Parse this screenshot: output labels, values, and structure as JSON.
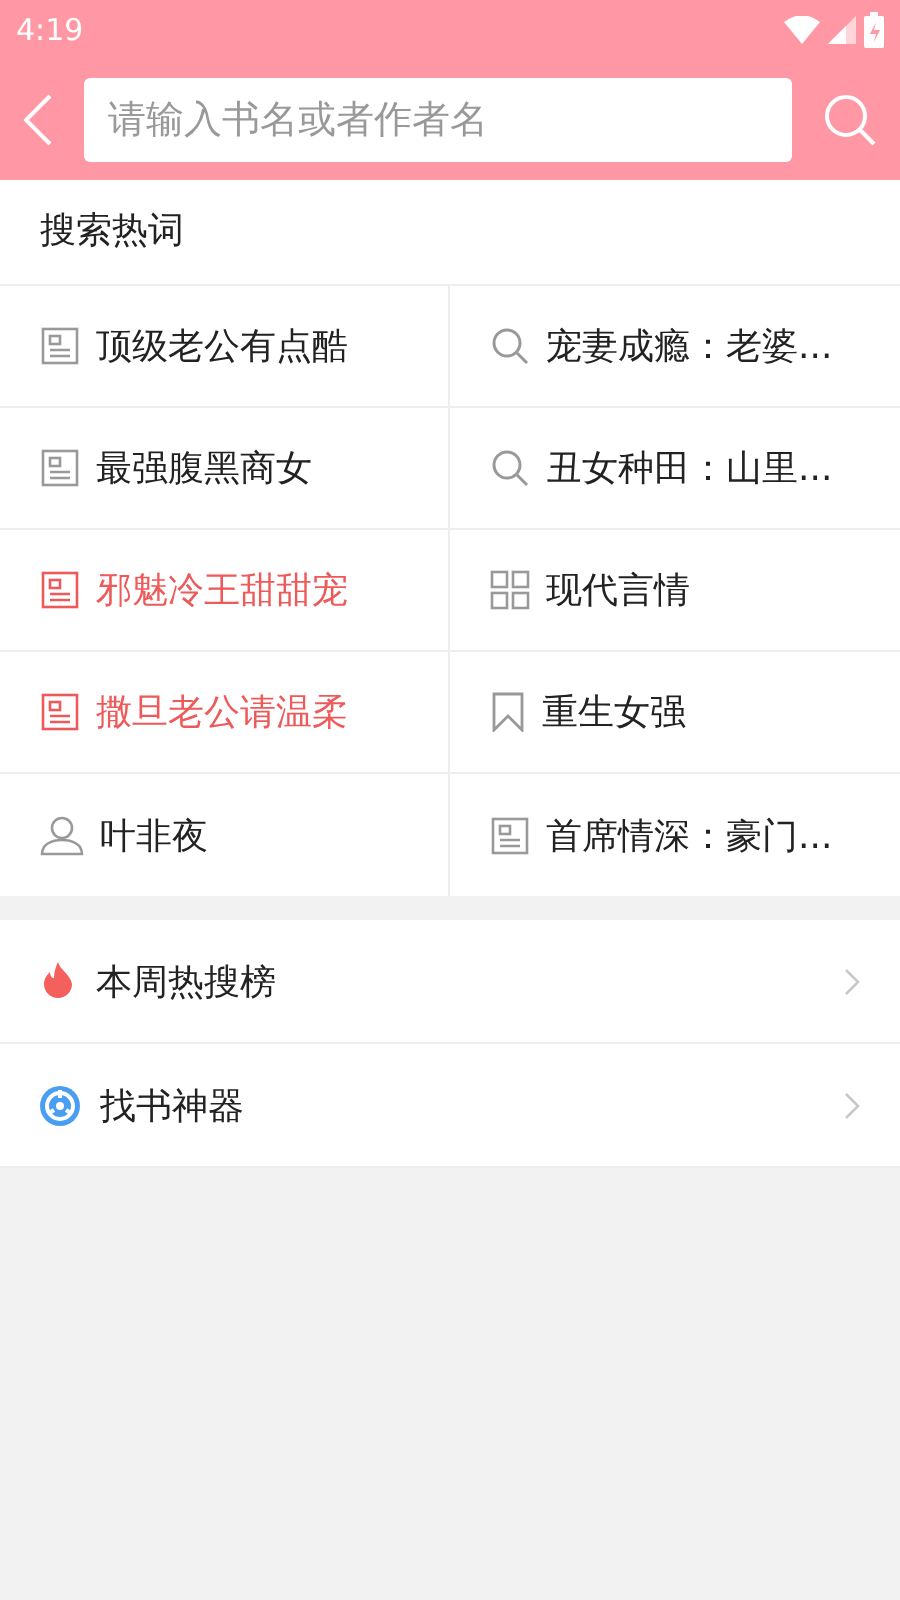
{
  "status_bar": {
    "time": "4:19"
  },
  "search": {
    "placeholder": "请输入书名或者作者名"
  },
  "hot_words": {
    "title": "搜索热词",
    "items": [
      {
        "label": "顶级老公有点酷",
        "kind": "book",
        "hot": false
      },
      {
        "label": "宠妻成瘾：老婆...",
        "kind": "search",
        "hot": false
      },
      {
        "label": "最强腹黑商女",
        "kind": "book",
        "hot": false
      },
      {
        "label": "丑女种田：山里...",
        "kind": "search",
        "hot": false
      },
      {
        "label": "邪魅冷王甜甜宠",
        "kind": "book",
        "hot": true
      },
      {
        "label": "现代言情",
        "kind": "category",
        "hot": false
      },
      {
        "label": "撒旦老公请温柔",
        "kind": "book",
        "hot": true
      },
      {
        "label": "重生女强",
        "kind": "tag",
        "hot": false
      },
      {
        "label": "叶非夜",
        "kind": "author",
        "hot": false
      },
      {
        "label": "首席情深：豪门...",
        "kind": "book",
        "hot": false
      }
    ]
  },
  "menu": [
    {
      "label": "本周热搜榜",
      "kind": "flame"
    },
    {
      "label": "找书神器",
      "kind": "finder"
    }
  ]
}
